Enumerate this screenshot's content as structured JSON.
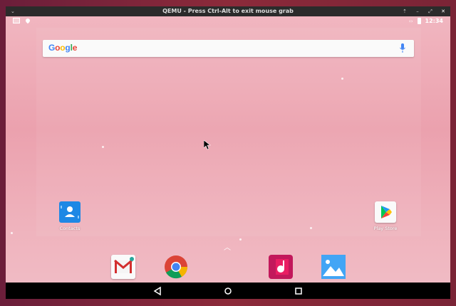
{
  "window": {
    "title": "QEMU - Press Ctrl-Alt to exit mouse grab"
  },
  "statusbar": {
    "time": "12:34"
  },
  "search": {
    "logo_letters": [
      "G",
      "o",
      "o",
      "g",
      "l",
      "e"
    ]
  },
  "apps": {
    "contacts_label": "Contacts",
    "playstore_label": "Play Store"
  },
  "dock": [
    "gmail",
    "chrome",
    "music",
    "photos"
  ],
  "colors": {
    "titlebar": "#2b2b2b",
    "wallpaper": "#eba1ae",
    "navbar": "#000000"
  }
}
